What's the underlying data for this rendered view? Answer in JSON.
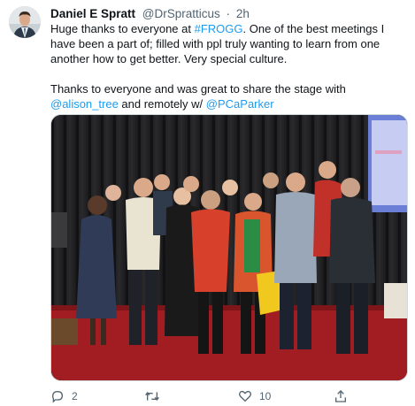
{
  "tweet": {
    "author": {
      "display_name": "Daniel E Spratt",
      "handle": "@DrSpratticus"
    },
    "separator": "·",
    "time": "2h",
    "text": {
      "p1_before": "Huge thanks to everyone at ",
      "hashtag": "#FROGG",
      "p1_after": ". One of the best meetings I have been a part of; filled with ppl truly wanting to learn from one another how to get better. Very special culture.",
      "p2_before": "Thanks to everyone and was great to share the stage with ",
      "mention1": "@alison_tree",
      "p2_middle": " and remotely w/ ",
      "mention2": "@PCaParker"
    },
    "media": {
      "type": "photo",
      "subject": "group-photo"
    },
    "actions": {
      "reply": {
        "icon": "reply-icon",
        "count": "2"
      },
      "retweet": {
        "icon": "retweet-icon",
        "count": ""
      },
      "like": {
        "icon": "heart-icon",
        "count": "10"
      },
      "share": {
        "icon": "share-icon",
        "count": ""
      }
    }
  },
  "colors": {
    "accent": "#1d9bf0",
    "text": "#0f1419",
    "secondary": "#536471",
    "carpet": "#a11d22"
  }
}
